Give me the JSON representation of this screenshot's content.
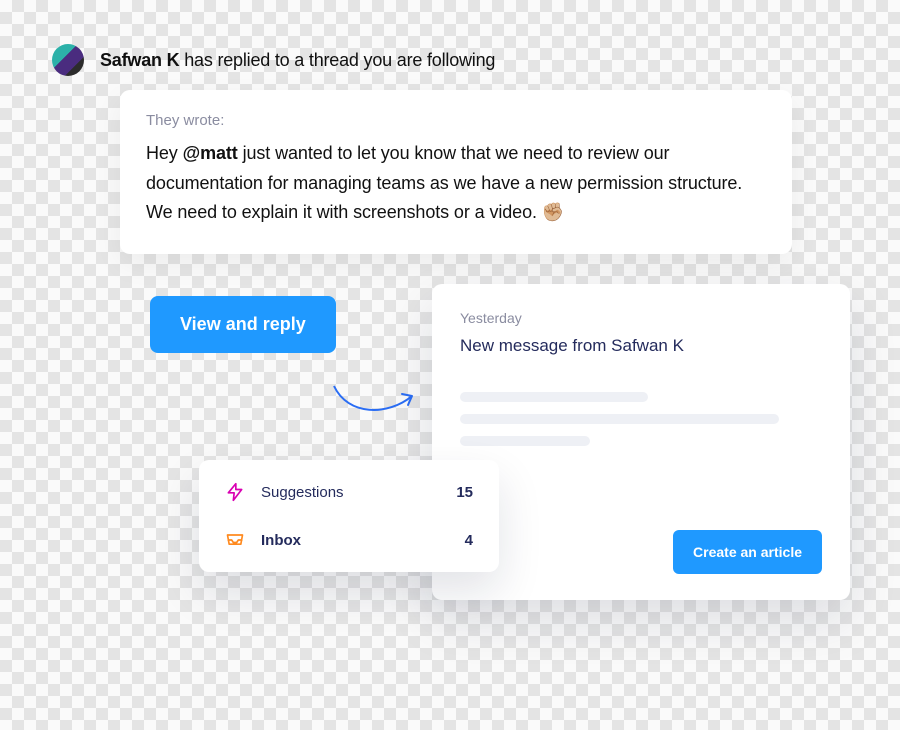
{
  "notification": {
    "author": "Safwan K",
    "suffix_text": " has replied to a thread you are following"
  },
  "quote": {
    "label": "They wrote:",
    "body_prefix": "Hey ",
    "mention": "@matt",
    "body_after": " just wanted to let you know that we need to review our documentation for managing teams as we have a new permission structure. We need to explain it with screenshots or a video. ✊🏼"
  },
  "cta": {
    "view_reply": "View and reply"
  },
  "inbox_card": {
    "date_label": "Yesterday",
    "title": "New message from Safwan K",
    "create_button": "Create an article"
  },
  "sidebar": {
    "items": [
      {
        "label": "Suggestions",
        "count": "15"
      },
      {
        "label": "Inbox",
        "count": "4"
      }
    ]
  }
}
